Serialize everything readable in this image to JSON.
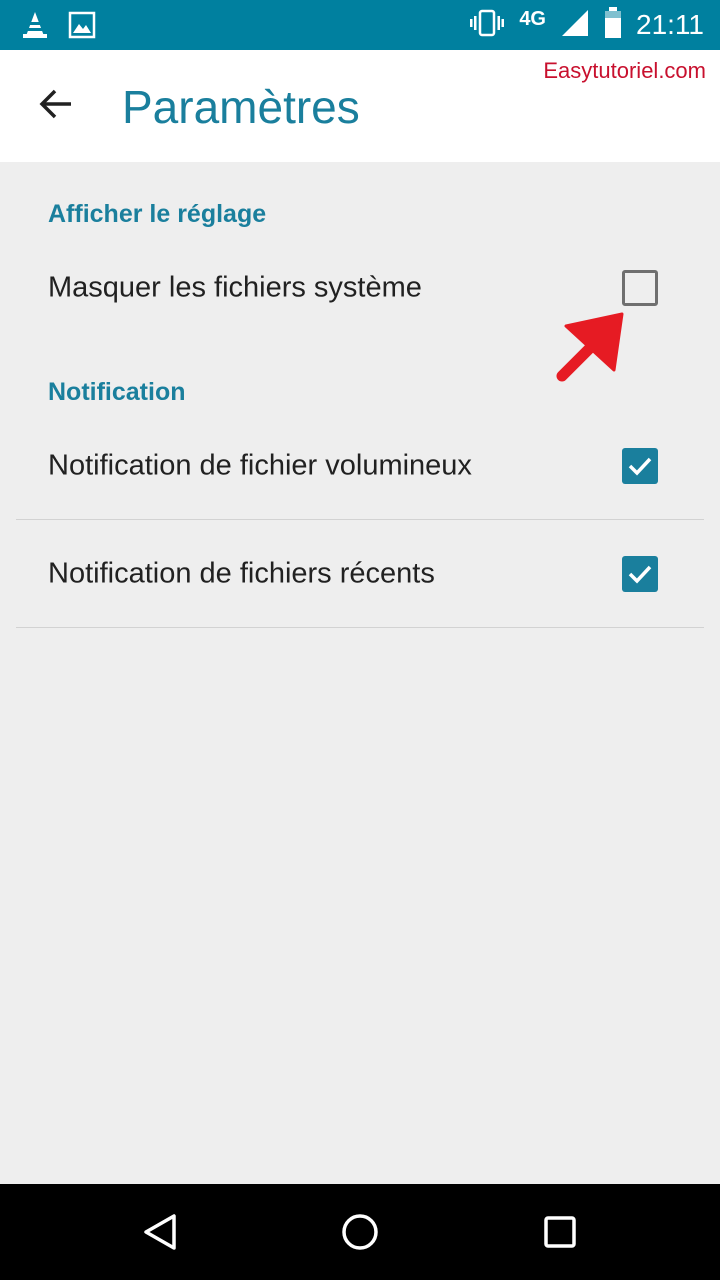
{
  "status_bar": {
    "network": "4G",
    "time": "21:11",
    "icons": [
      "vlc-cone-icon",
      "image-icon",
      "vibrate-icon",
      "signal-icon",
      "battery-icon"
    ]
  },
  "app_bar": {
    "title": "Paramètres",
    "back_icon": "arrow-back-icon",
    "watermark": "Easytutoriel.com"
  },
  "settings": {
    "sections": [
      {
        "header": "Afficher le réglage",
        "items": [
          {
            "label": "Masquer les fichiers système",
            "checked": false
          }
        ]
      },
      {
        "header": "Notification",
        "items": [
          {
            "label": "Notification de fichier volumineux",
            "checked": true
          },
          {
            "label": "Notification de fichiers récents",
            "checked": true
          }
        ]
      }
    ]
  },
  "annotation": {
    "icon": "red-arrow-icon",
    "color": "#e61b23"
  },
  "nav_bar": {
    "icons": [
      "back-triangle-icon",
      "home-circle-icon",
      "recents-square-icon"
    ]
  },
  "colors": {
    "status_bar": "#00809f",
    "accent": "#1a7f9d",
    "background": "#eeeeee",
    "text": "#212121",
    "nav_bar": "#000000"
  }
}
